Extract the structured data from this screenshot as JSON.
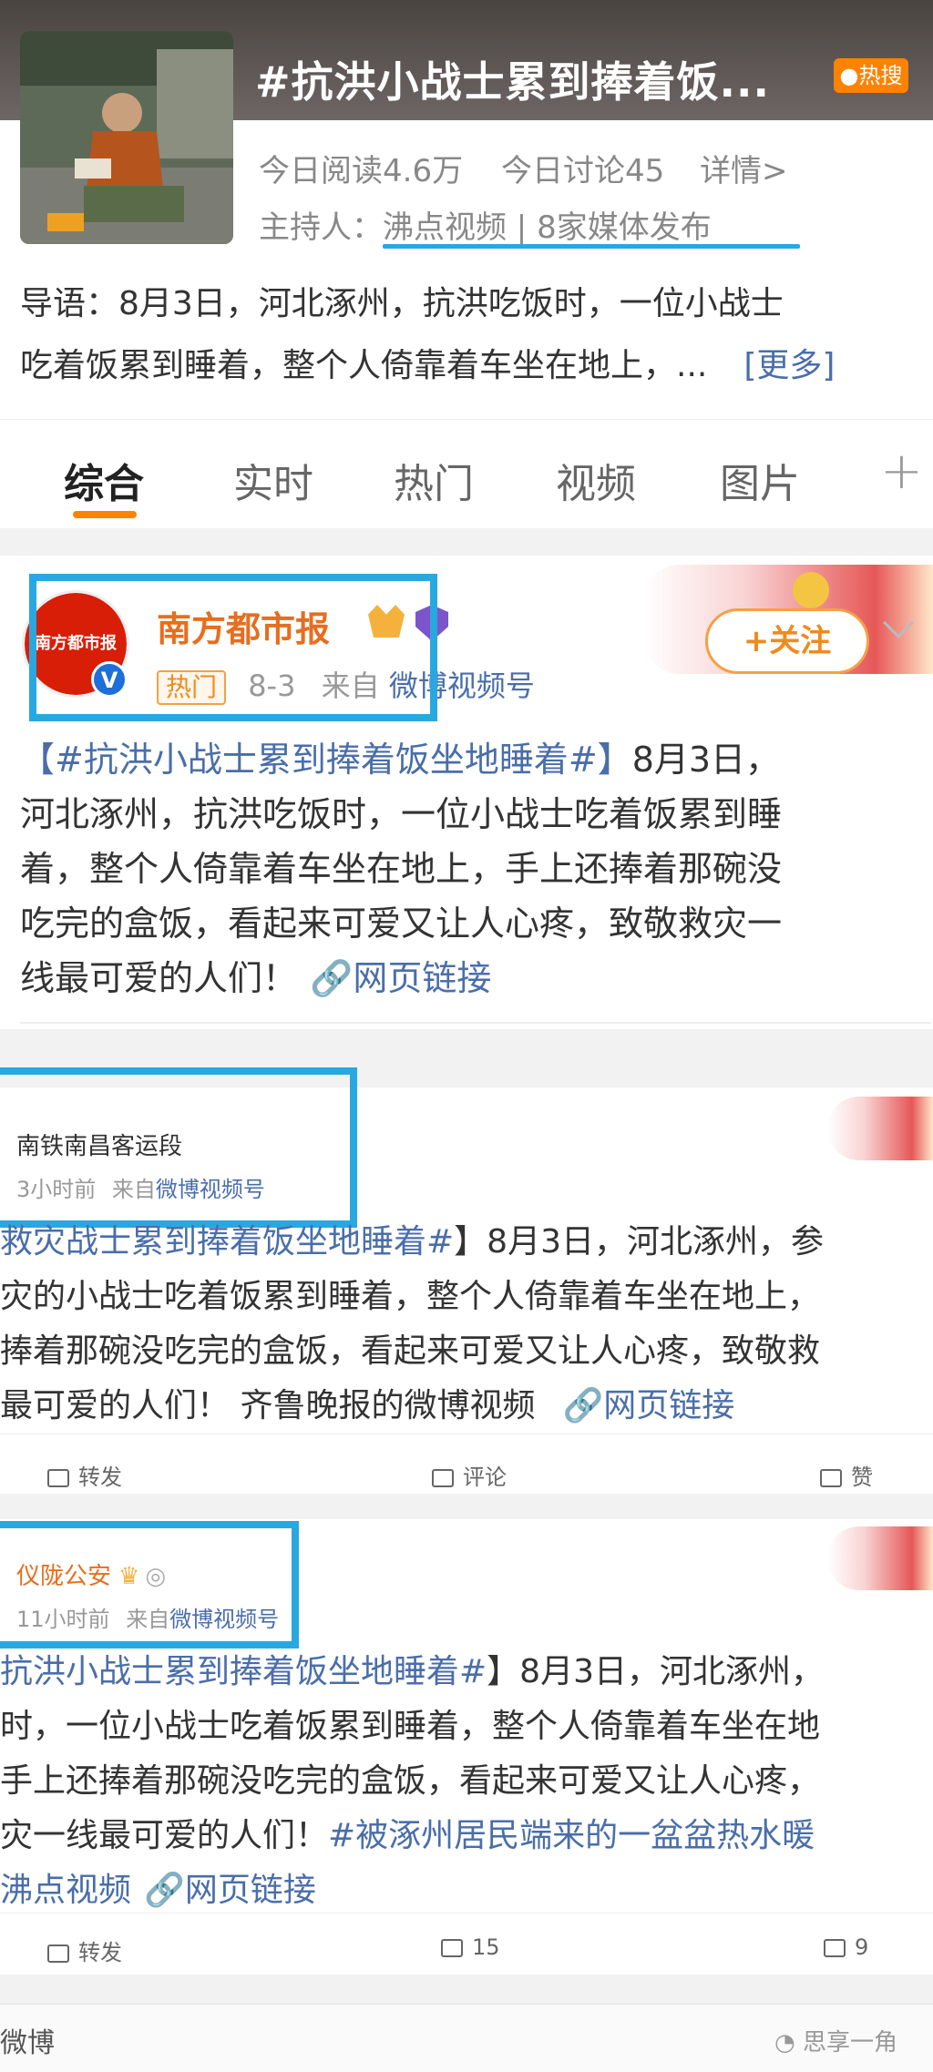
{
  "topic": {
    "title": "#抗洪小战士累到捧着饭...",
    "hot_badge": "热搜",
    "reads": "今日阅读4.6万",
    "discussions": "今日讨论45",
    "details": "详情>",
    "host": "主持人：沸点视频 | 8家媒体发布",
    "intro_line1": "导语：8月3日，河北涿州，抗洪吃饭时，一位小战士",
    "intro_line2": "吃着饭累到睡着，整个人倚靠着车坐在地上，...",
    "intro_more": "[更多]"
  },
  "tabs": [
    "综合",
    "实时",
    "热门",
    "视频",
    "图片"
  ],
  "tab_plus": "+",
  "post1": {
    "avatar_text": "南方都市报",
    "author": "南方都市报",
    "hot_tag": "热门",
    "date": "8-3",
    "source_prefix": "来自",
    "source": "微博视频号",
    "follow": "+关注",
    "hashtag": "【#抗洪小战士累到捧着饭坐地睡着#】",
    "line1_tail": "8月3日，",
    "line2": "河北涿州，抗洪吃饭时，一位小战士吃着饭累到睡",
    "line3": "着，整个人倚靠着车坐在地上，手上还捧着那碗没",
    "line4": "吃完的盒饭，看起来可爱又让人心疼，致敬救灾一",
    "line5": "线最可爱的人们！",
    "link": "网页链接"
  },
  "post2": {
    "author": "南铁南昌客运段",
    "time": "3小时前",
    "source_prefix": "来自",
    "source": "微博视频号",
    "hashtag": "救灾战士累到捧着饭坐地睡着#",
    "line1_tail": "】8月3日，河北涿州，参",
    "line2": "灾的小战士吃着饭累到睡着，整个人倚靠着车坐在地上，",
    "line3": "捧着那碗没吃完的盒饭，看起来可爱又让人心疼，致敬救",
    "line4": "最可爱的人们！ 齐鲁晚报的微博视频",
    "link": "网页链接",
    "repost": "转发",
    "comment": "评论",
    "like": "赞"
  },
  "post3": {
    "author": "仪陇公安",
    "time": "11小时前",
    "source_prefix": "来自",
    "source": "微博视频号",
    "hashtag": "抗洪小战士累到捧着饭坐地睡着#",
    "line1_tail": "】8月3日，河北涿州，",
    "line2": "时，一位小战士吃着饭累到睡着，整个人倚靠着车坐在地",
    "line3": "手上还捧着那碗没吃完的盒饭，看起来可爱又让人心疼，",
    "line4_head": "灾一线最可爱的人们！",
    "line4_tag": "#被涿州居民端来的一盆盆热水暖",
    "line5_head": "沸点视频",
    "link": "网页链接",
    "repost": "转发",
    "comment_count": "15",
    "like_count": "9"
  },
  "bottom": {
    "app_name": "微博",
    "watermark": "思享一角"
  },
  "colors": {
    "accent_orange": "#ff8200",
    "link_blue": "#4a6ea9",
    "highlight_blue": "#29a8e0",
    "author_orange": "#e66e1f"
  }
}
